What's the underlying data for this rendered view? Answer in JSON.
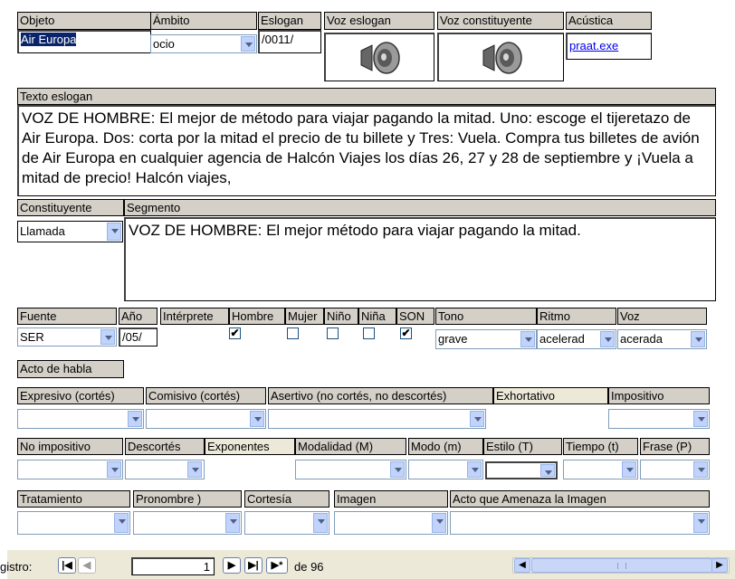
{
  "header": {
    "labels": {
      "objeto": "Objeto",
      "ambito": "Ámbito",
      "eslogan": "Eslogan",
      "voz_eslogan": "Voz eslogan",
      "voz_constituyente": "Voz constituyente",
      "acustica": "Acústica"
    },
    "values": {
      "objeto": "Air Europa",
      "ambito": "ocio",
      "eslogan": "/0011/",
      "acustica": "praat.exe"
    }
  },
  "texto_eslogan": {
    "label": "Texto eslogan",
    "value": "VOZ DE HOMBRE: El mejor de método para viajar pagando la mitad. Uno: escoge el tijeretazo de Air Europa. Dos: corta por la mitad el precio de tu billete y Tres: Vuela. Compra tus billetes de avión de Air Europa en cualquier agencia de Halcón Viajes los días 26, 27 y 28 de septiembre y ¡Vuela a mitad de precio! Halcón viajes,"
  },
  "constituyente": {
    "label": "Constituyente",
    "value": "Llamada"
  },
  "segmento": {
    "label": "Segmento",
    "value": "VOZ DE HOMBRE: El mejor  método para viajar pagando la mitad."
  },
  "row_fuente": {
    "labels": {
      "fuente": "Fuente",
      "anio": "Año",
      "interprete": "Intérprete",
      "hombre": "Hombre",
      "mujer": "Mujer",
      "nino": "Niño",
      "nina": "Niña",
      "son": "SON",
      "tono": "Tono",
      "ritmo": "Ritmo",
      "voz": "Voz"
    },
    "values": {
      "fuente": "SER",
      "anio": "/05/",
      "tono": "grave",
      "ritmo": "acelerad",
      "voz": "acerada"
    },
    "checks": {
      "hombre": "✔",
      "mujer": "",
      "nino": "",
      "nina": "",
      "son": "✔"
    }
  },
  "acto_de_habla": {
    "label": "Acto de habla"
  },
  "row_expresivo": {
    "labels": {
      "expresivo": "Expresivo (cortés)",
      "comisivo": "Comisivo (cortés)",
      "asertivo": "Asertivo (no cortés, no descortés)",
      "exhortativo": "Exhortativo",
      "impositivo": "Impositivo"
    }
  },
  "row_no_impositivo": {
    "labels": {
      "no_impositivo": "No impositivo",
      "descortes": "Descortés",
      "exponentes": "Exponentes",
      "modalidad": "Modalidad (M)",
      "modo": "Modo (m)",
      "estilo": "Estilo (T)",
      "tiempo": "Tiempo (t)",
      "frase": "Frase (P)"
    }
  },
  "row_tratamiento": {
    "labels": {
      "tratamiento": "Tratamiento",
      "pronombre": "Pronombre )",
      "cortesia": "Cortesía",
      "imagen": "Imagen",
      "acto_amenaza": "Acto que Amenaza la Imagen"
    }
  },
  "record_nav": {
    "label": "gistro:",
    "current": "1",
    "of_label": "de 96",
    "first_icon": "first-record-icon",
    "prev_icon": "previous-record-icon",
    "next_icon": "next-record-icon",
    "last_icon": "last-record-icon",
    "new_icon": "new-record-icon"
  },
  "colors": {
    "label_bg": "#d4d0c8",
    "combo_button": "#c1d3fb",
    "link": "#0000ee"
  }
}
